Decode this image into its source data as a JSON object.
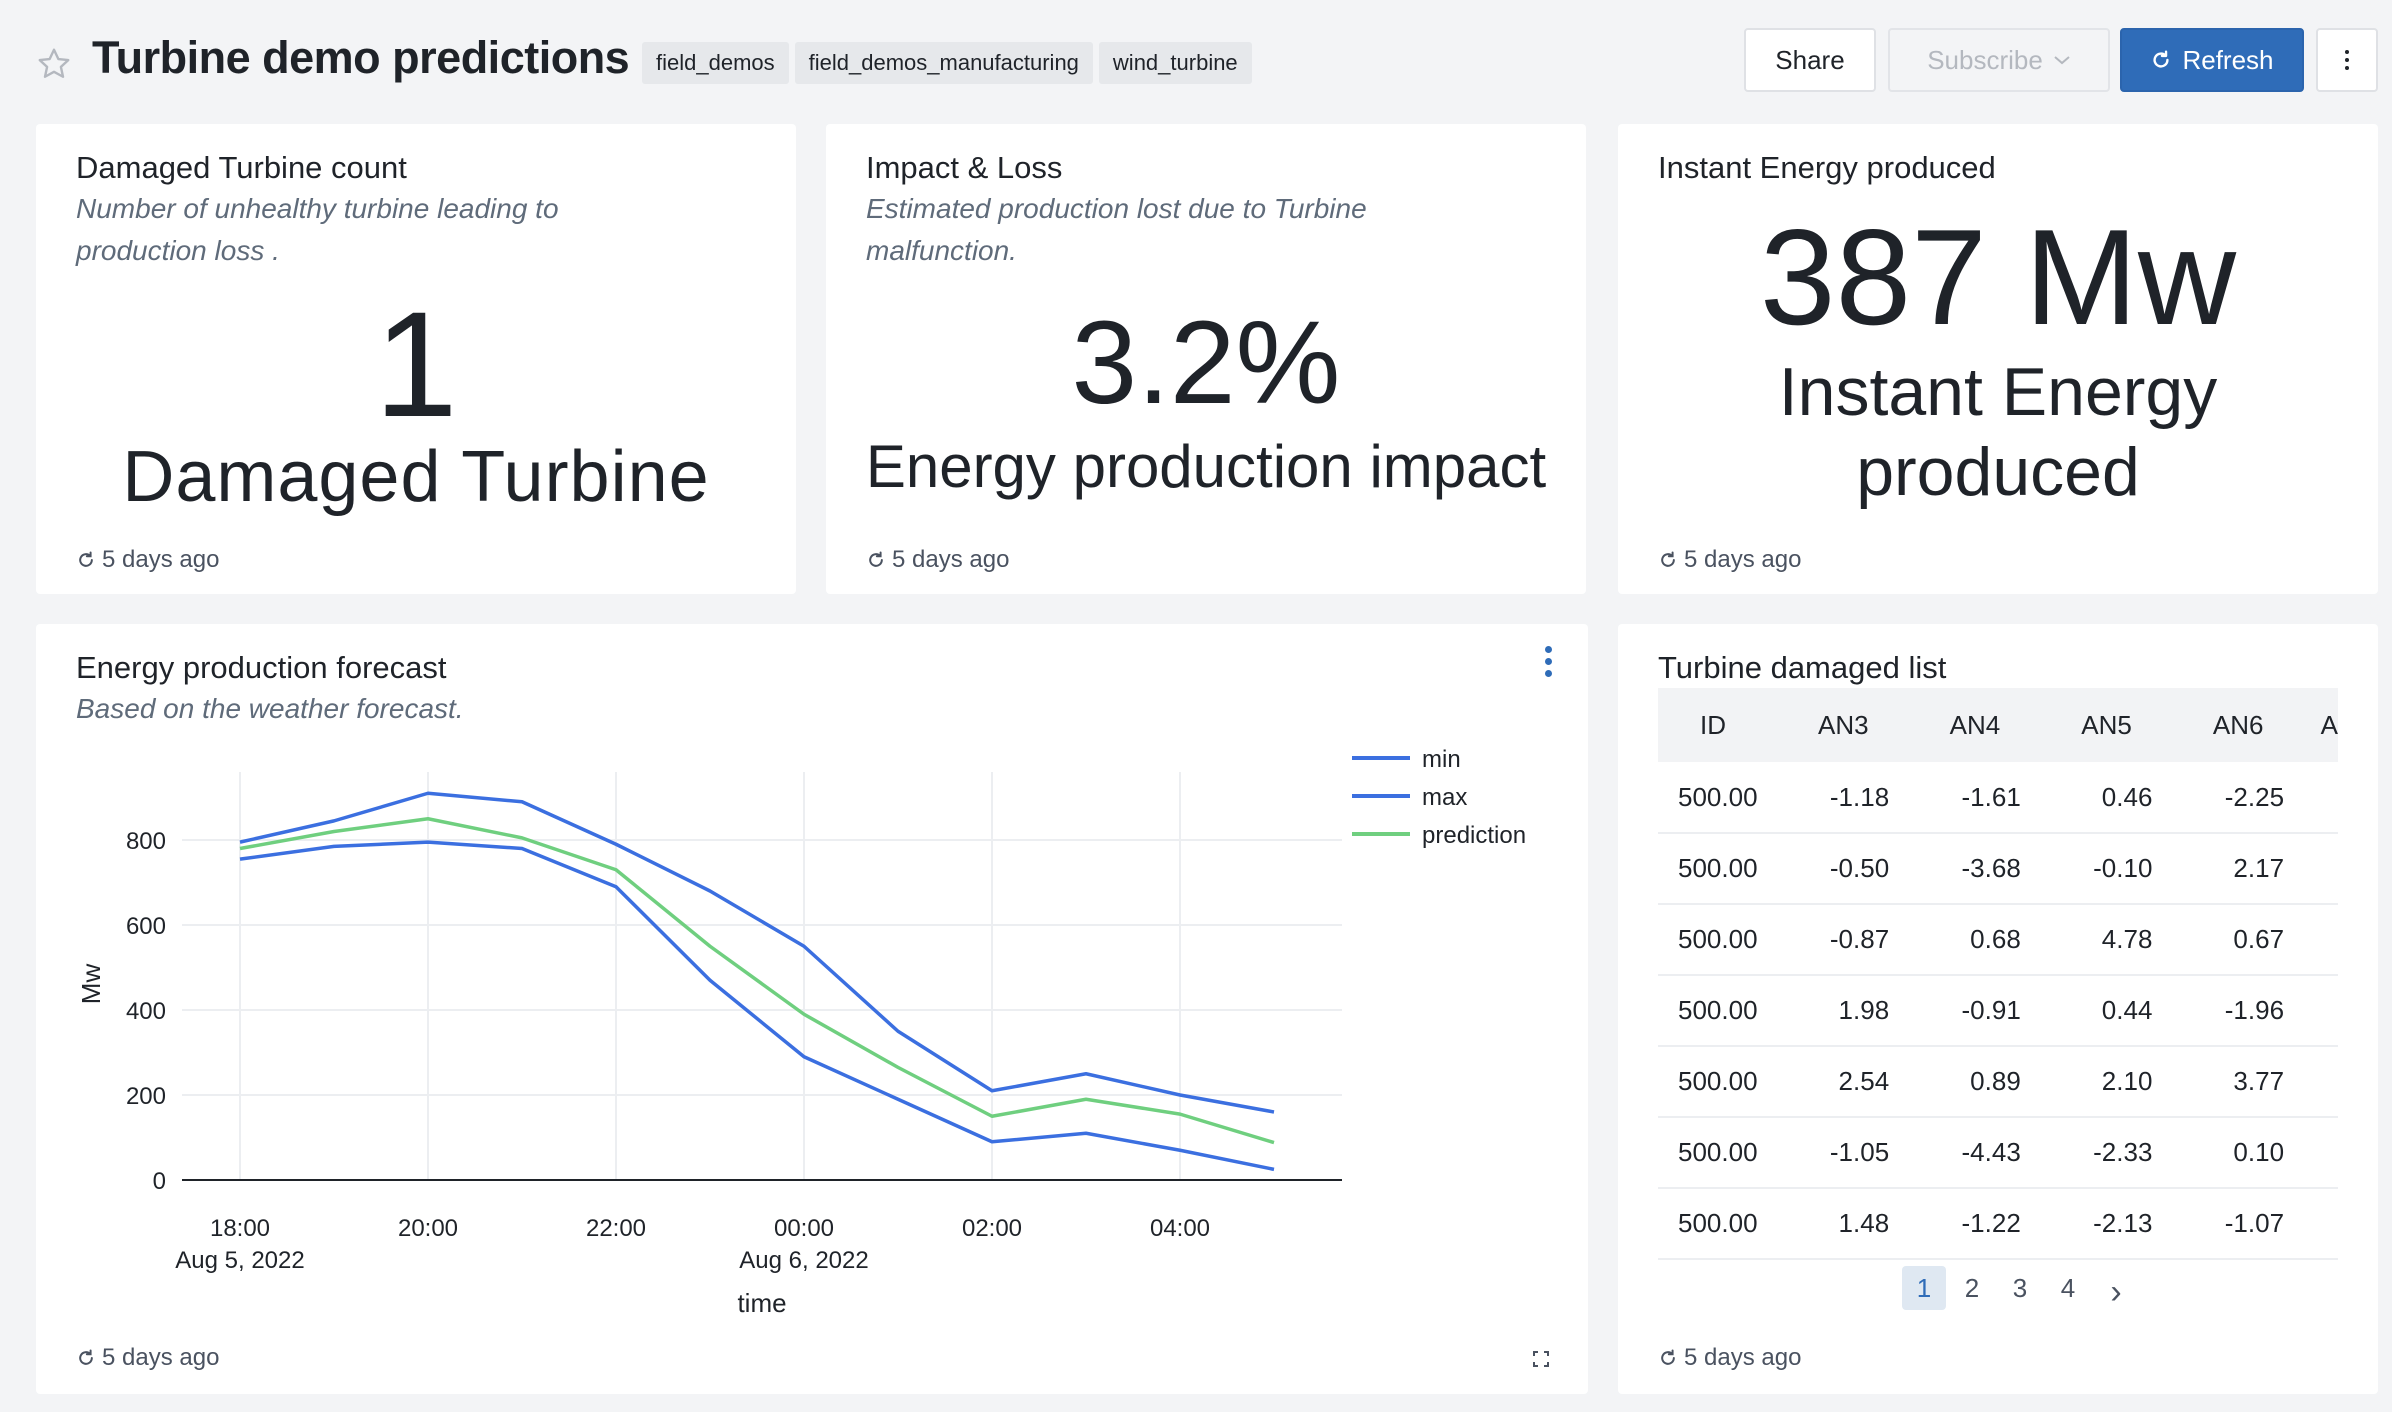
{
  "header": {
    "title": "Turbine demo predictions",
    "tags": [
      "field_demos",
      "field_demos_manufacturing",
      "wind_turbine"
    ],
    "share_label": "Share",
    "subscribe_label": "Subscribe",
    "refresh_label": "Refresh"
  },
  "cards": {
    "damaged": {
      "title": "Damaged Turbine count",
      "description": "Number of unhealthy turbine leading to production loss .",
      "value": "1",
      "label": "Damaged Turbine",
      "updated": "5 days ago"
    },
    "impact": {
      "title": "Impact & Loss",
      "description": "Estimated production lost due to Turbine malfunction.",
      "value": "3.2%",
      "label": "Energy production impact",
      "updated": "5 days ago"
    },
    "energy": {
      "title": "Instant Energy produced",
      "value": "387 Mw",
      "label_line1": "Instant Energy",
      "label_line2": "produced",
      "updated": "5 days ago"
    },
    "forecast": {
      "title": "Energy production forecast",
      "description": "Based on the weather forecast.",
      "updated": "5 days ago"
    },
    "list": {
      "title": "Turbine damaged list",
      "columns": [
        "ID",
        "AN3",
        "AN4",
        "AN5",
        "AN6",
        "A"
      ],
      "rows": [
        [
          "500.00",
          "-1.18",
          "-1.61",
          "0.46",
          "-2.25"
        ],
        [
          "500.00",
          "-0.50",
          "-3.68",
          "-0.10",
          "2.17"
        ],
        [
          "500.00",
          "-0.87",
          "0.68",
          "4.78",
          "0.67"
        ],
        [
          "500.00",
          "1.98",
          "-0.91",
          "0.44",
          "-1.96"
        ],
        [
          "500.00",
          "2.54",
          "0.89",
          "2.10",
          "3.77"
        ],
        [
          "500.00",
          "-1.05",
          "-4.43",
          "-2.33",
          "0.10"
        ],
        [
          "500.00",
          "1.48",
          "-1.22",
          "-2.13",
          "-1.07"
        ]
      ],
      "pages": [
        "1",
        "2",
        "3",
        "4"
      ],
      "current_page": "1",
      "next_label": "›",
      "updated": "5 days ago"
    }
  },
  "chart_data": {
    "type": "line",
    "xlabel": "time",
    "ylabel": "Mw",
    "ylim": [
      0,
      900
    ],
    "yticks": [
      0,
      200,
      400,
      600,
      800
    ],
    "x": [
      "2022-08-05 18:00",
      "2022-08-05 19:00",
      "2022-08-05 20:00",
      "2022-08-05 21:00",
      "2022-08-05 22:00",
      "2022-08-05 23:00",
      "2022-08-06 00:00",
      "2022-08-06 01:00",
      "2022-08-06 02:00",
      "2022-08-06 03:00",
      "2022-08-06 04:00",
      "2022-08-06 05:00"
    ],
    "xticks": [
      {
        "x": "2022-08-05 18:00",
        "line1": "18:00",
        "line2": "Aug 5, 2022"
      },
      {
        "x": "2022-08-05 20:00",
        "line1": "20:00",
        "line2": ""
      },
      {
        "x": "2022-08-05 22:00",
        "line1": "22:00",
        "line2": ""
      },
      {
        "x": "2022-08-06 00:00",
        "line1": "00:00",
        "line2": "Aug 6, 2022"
      },
      {
        "x": "2022-08-06 02:00",
        "line1": "02:00",
        "line2": ""
      },
      {
        "x": "2022-08-06 04:00",
        "line1": "04:00",
        "line2": ""
      }
    ],
    "series": [
      {
        "name": "min",
        "color": "#3b6fe0",
        "values": [
          755,
          785,
          795,
          780,
          690,
          470,
          290,
          190,
          90,
          110,
          70,
          25
        ]
      },
      {
        "name": "max",
        "color": "#3b6fe0",
        "values": [
          795,
          845,
          910,
          890,
          790,
          680,
          550,
          350,
          210,
          250,
          200,
          160
        ]
      },
      {
        "name": "prediction",
        "color": "#6fcf7f",
        "values": [
          780,
          820,
          850,
          805,
          730,
          550,
          390,
          265,
          150,
          190,
          155,
          88
        ]
      }
    ],
    "grid": true,
    "legend": "top-right"
  },
  "colors": {
    "accent": "#2f6cb8",
    "line_blue": "#3b6fe0",
    "line_green": "#6fcf7f"
  }
}
